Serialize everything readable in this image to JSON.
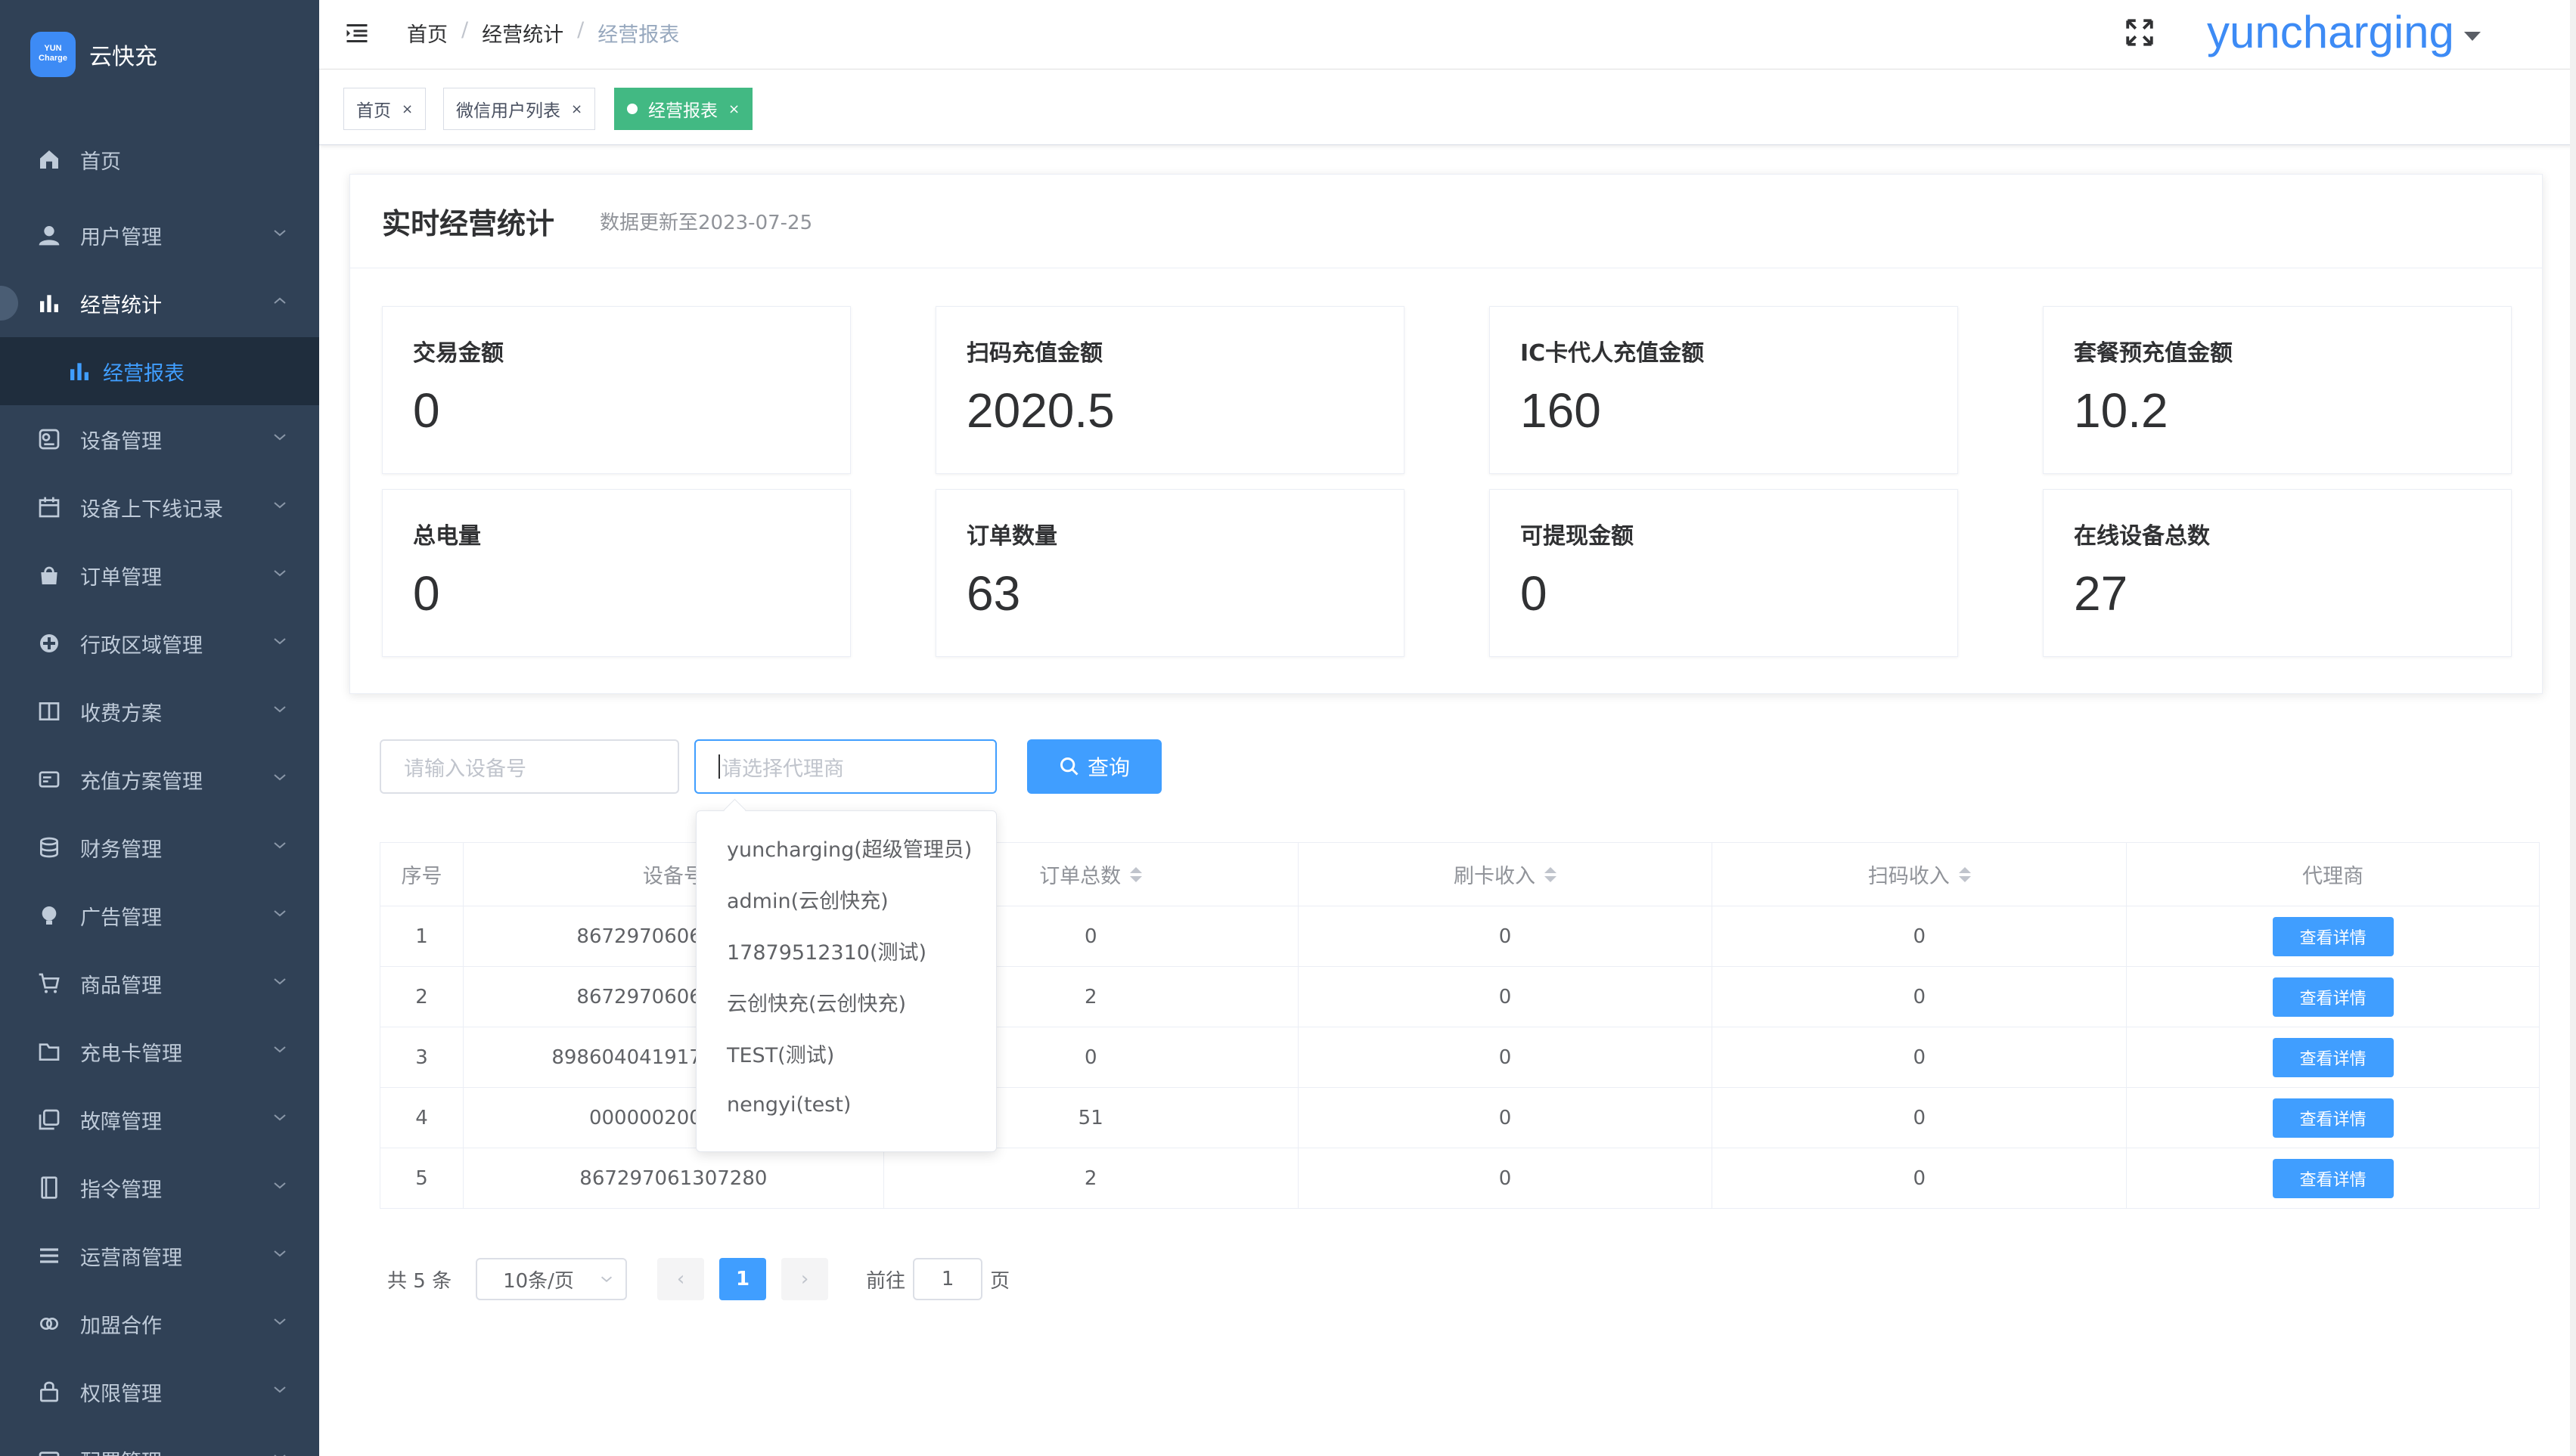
{
  "app": {
    "logo_badge": "YUN Charge",
    "name": "云快充"
  },
  "sidebar": {
    "items": [
      {
        "label": "首页",
        "icon": "home-icon"
      },
      {
        "label": "用户管理",
        "icon": "user-icon"
      },
      {
        "label": "经营统计",
        "icon": "bar-chart-icon",
        "expanded": true
      },
      {
        "label": "经营报表",
        "icon": "bar-chart-icon",
        "active": true
      },
      {
        "label": "设备管理",
        "icon": "device-icon"
      },
      {
        "label": "设备上下线记录",
        "icon": "calendar-icon"
      },
      {
        "label": "订单管理",
        "icon": "bag-icon"
      },
      {
        "label": "行政区域管理",
        "icon": "region-icon"
      },
      {
        "label": "收费方案",
        "icon": "book-icon"
      },
      {
        "label": "充值方案管理",
        "icon": "card-icon"
      },
      {
        "label": "财务管理",
        "icon": "coins-icon"
      },
      {
        "label": "广告管理",
        "icon": "bulb-icon"
      },
      {
        "label": "商品管理",
        "icon": "cart-icon"
      },
      {
        "label": "充电卡管理",
        "icon": "folder-icon"
      },
      {
        "label": "故障管理",
        "icon": "copy-icon"
      },
      {
        "label": "指令管理",
        "icon": "notebook-icon"
      },
      {
        "label": "运营商管理",
        "icon": "list-icon"
      },
      {
        "label": "加盟合作",
        "icon": "link-icon"
      },
      {
        "label": "权限管理",
        "icon": "lock-icon"
      },
      {
        "label": "配置管理",
        "icon": "settings-icon"
      }
    ]
  },
  "navbar": {
    "breadcrumb": [
      "首页",
      "经营统计",
      "经营报表"
    ],
    "username": "yuncharging"
  },
  "tags": [
    {
      "label": "首页"
    },
    {
      "label": "微信用户列表"
    },
    {
      "label": "经营报表",
      "active": true
    }
  ],
  "stats": {
    "title": "实时经营统计",
    "updated": "数据更新至2023-07-25",
    "items": [
      {
        "label": "交易金额",
        "value": "0"
      },
      {
        "label": "扫码充值金额",
        "value": "2020.5"
      },
      {
        "label": "IC卡代人充值金额",
        "value": "160"
      },
      {
        "label": "套餐预充值金额",
        "value": "10.2"
      },
      {
        "label": "总电量",
        "value": "0"
      },
      {
        "label": "订单数量",
        "value": "63"
      },
      {
        "label": "可提现金额",
        "value": "0"
      },
      {
        "label": "在线设备总数",
        "value": "27"
      }
    ]
  },
  "filters": {
    "device_placeholder": "请输入设备号",
    "agent_placeholder": "请选择代理商",
    "query_label": "查询"
  },
  "dropdown": {
    "options": [
      "yuncharging(超级管理员)",
      "admin(云创快充)",
      "17879512310(测试)",
      "云创快充(云创快充)",
      "TEST(测试)",
      "nengyi(test)"
    ]
  },
  "table": {
    "headers": [
      "序号",
      "设备号",
      "订单总数",
      "刷卡收入",
      "扫码收入",
      "代理商"
    ],
    "action_label": "查看详情",
    "rows": [
      {
        "index": "1",
        "device": "8672970606",
        "orders": "0",
        "card": "0",
        "scan": "0"
      },
      {
        "index": "2",
        "device": "8672970606",
        "orders": "2",
        "card": "0",
        "scan": "0"
      },
      {
        "index": "3",
        "device": "898604041917",
        "orders": "0",
        "card": "0",
        "scan": "0"
      },
      {
        "index": "4",
        "device": "000000200",
        "orders": "51",
        "card": "0",
        "scan": "0"
      },
      {
        "index": "5",
        "device": "867297061307280",
        "orders": "2",
        "card": "0",
        "scan": "0"
      }
    ]
  },
  "pagination": {
    "total": "共 5 条",
    "page_size": "10条/页",
    "prev": "‹",
    "current": "1",
    "next": "›",
    "goto_prefix": "前往",
    "goto_value": "1",
    "goto_suffix": "页"
  },
  "colors": {
    "sidebar_bg": "#304156",
    "accent": "#409eff",
    "tag_active": "#42b983"
  }
}
